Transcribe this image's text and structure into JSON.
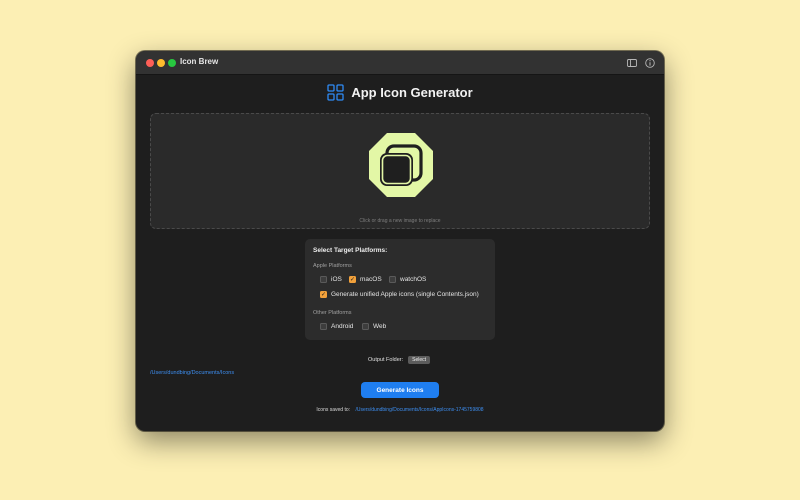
{
  "window": {
    "title": "Icon Brew",
    "toolbar_icons": [
      "sidebar-icon",
      "info-icon"
    ]
  },
  "header": {
    "icon": "grid-icon",
    "title": "App Icon Generator"
  },
  "dropzone": {
    "preview_icon": "stacked-squares-icon",
    "hint": "Click or drag a new image to replace"
  },
  "platforms": {
    "title": "Select Target Platforms:",
    "apple": {
      "label": "Apple Platforms",
      "options": [
        {
          "label": "iOS",
          "checked": false
        },
        {
          "label": "macOS",
          "checked": true
        },
        {
          "label": "watchOS",
          "checked": false
        }
      ],
      "unified": {
        "label": "Generate unified Apple icons (single Contents.json)",
        "checked": true
      }
    },
    "other": {
      "label": "Other Platforms",
      "options": [
        {
          "label": "Android",
          "checked": false
        },
        {
          "label": "Web",
          "checked": false
        }
      ]
    }
  },
  "output": {
    "label": "Output Folder:",
    "select_label": "Select",
    "path": "/Users/dundbing/Documents/Icons"
  },
  "generate": {
    "label": "Generate Icons"
  },
  "saved": {
    "label": "Icons saved to:",
    "path": "/Users/dundbing/Documents/Icons/AppIcons-1745759808"
  },
  "colors": {
    "background": "#fcefb4",
    "window": "#1e1e1e",
    "accent_blue": "#1f7ef0",
    "checkbox_on": "#f2a13b",
    "icon_green": "#e3f7a6"
  }
}
